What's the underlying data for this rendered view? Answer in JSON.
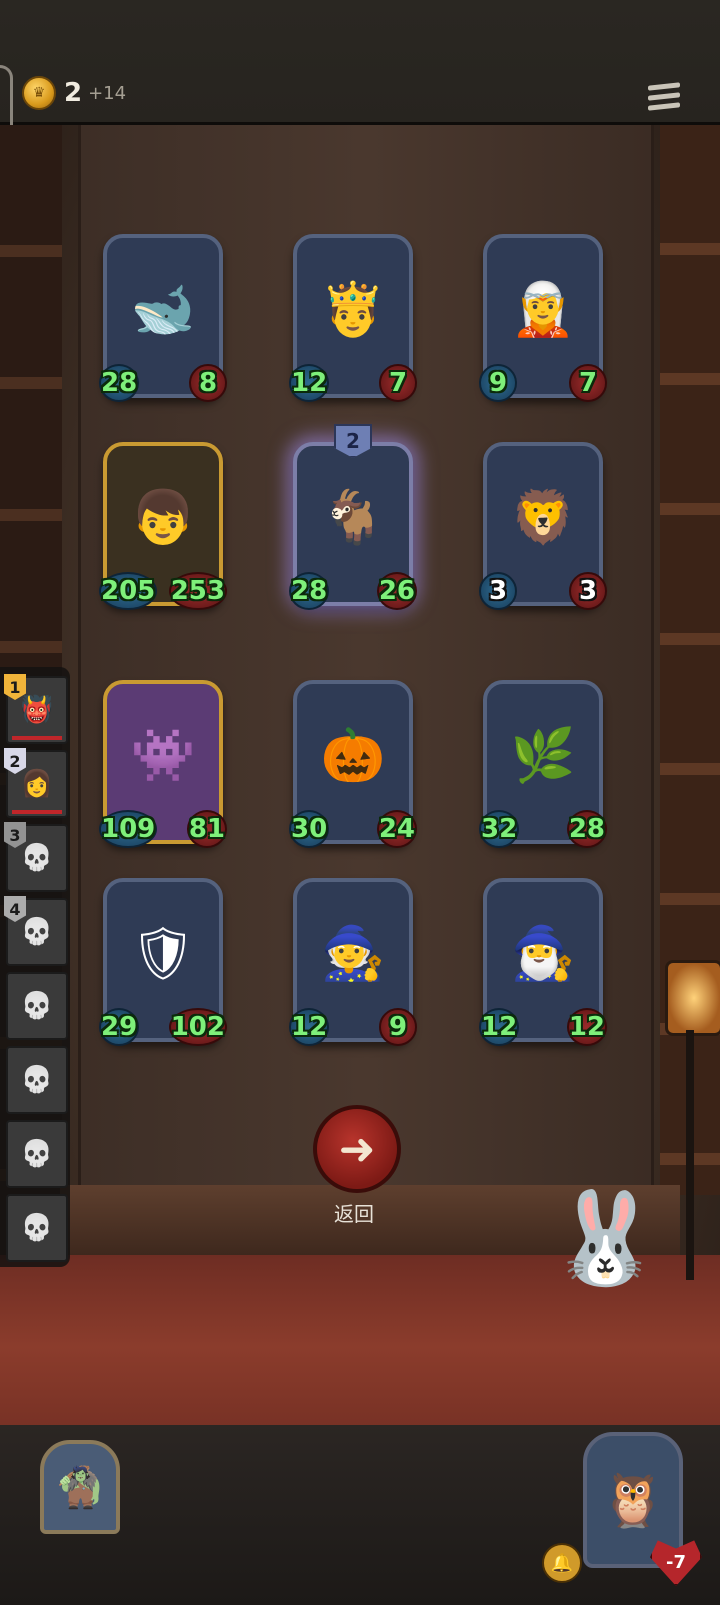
{
  "header": {
    "gold": "2",
    "gold_income": "+14",
    "menu_icon": "hamburger-icon"
  },
  "board": {
    "cards": [
      {
        "portrait": "🐋",
        "atk": "28",
        "hp": "8",
        "frame": "normal",
        "row": 0,
        "col": 0
      },
      {
        "portrait": "🤴",
        "atk": "12",
        "hp": "7",
        "frame": "normal",
        "row": 0,
        "col": 1
      },
      {
        "portrait": "🧝",
        "atk": "9",
        "hp": "7",
        "frame": "normal",
        "row": 0,
        "col": 2
      },
      {
        "portrait": "👦",
        "atk": "205",
        "hp": "253",
        "frame": "golden",
        "row": 1,
        "col": 0
      },
      {
        "portrait": "🐐",
        "atk": "28",
        "hp": "26",
        "frame": "glow",
        "tier": "2",
        "row": 1,
        "col": 1
      },
      {
        "portrait": "🦁",
        "atk": "3",
        "hp": "3",
        "frame": "normal",
        "white": true,
        "row": 1,
        "col": 2
      },
      {
        "portrait": "👾",
        "atk": "109",
        "hp": "81",
        "frame": "golden-purple",
        "row": 2,
        "col": 0
      },
      {
        "portrait": "🎃",
        "atk": "30",
        "hp": "24",
        "frame": "normal",
        "row": 2,
        "col": 1
      },
      {
        "portrait": "🌿",
        "atk": "32",
        "hp": "28",
        "frame": "normal",
        "row": 2,
        "col": 2
      },
      {
        "portrait": "🛡",
        "atk": "29",
        "hp": "102",
        "frame": "normal",
        "row": 3,
        "col": 0
      },
      {
        "portrait": "🧙",
        "atk": "12",
        "hp": "9",
        "frame": "normal",
        "row": 3,
        "col": 1
      },
      {
        "portrait": "🧙‍♂️",
        "atk": "12",
        "hp": "12",
        "frame": "normal",
        "row": 3,
        "col": 2
      }
    ]
  },
  "leaderboard": [
    {
      "rank": "1",
      "portrait": "👹",
      "rank_color": "#f0b43a",
      "hpbar": true
    },
    {
      "rank": "2",
      "portrait": "👩",
      "rank_color": "#d8d8e8",
      "hpbar": true
    },
    {
      "rank": "3",
      "portrait": "💀",
      "rank_color": "#c98a4a",
      "dead": true
    },
    {
      "rank": "4",
      "portrait": "💀",
      "rank_color": "#8fb0dc",
      "dead": true
    },
    {
      "rank": "",
      "portrait": "💀",
      "dead": true
    },
    {
      "rank": "",
      "portrait": "💀",
      "dead": true
    },
    {
      "rank": "",
      "portrait": "💀",
      "dead": true
    },
    {
      "rank": "",
      "portrait": "💀",
      "dead": true
    }
  ],
  "actions": {
    "return_label": "返回",
    "return_icon": "arrow-left-icon"
  },
  "opponent": {
    "hp": "-7"
  },
  "colors": {
    "atk_text": "#7ef07a",
    "gold": "#d99a1c",
    "return_button": "#9b2620"
  }
}
